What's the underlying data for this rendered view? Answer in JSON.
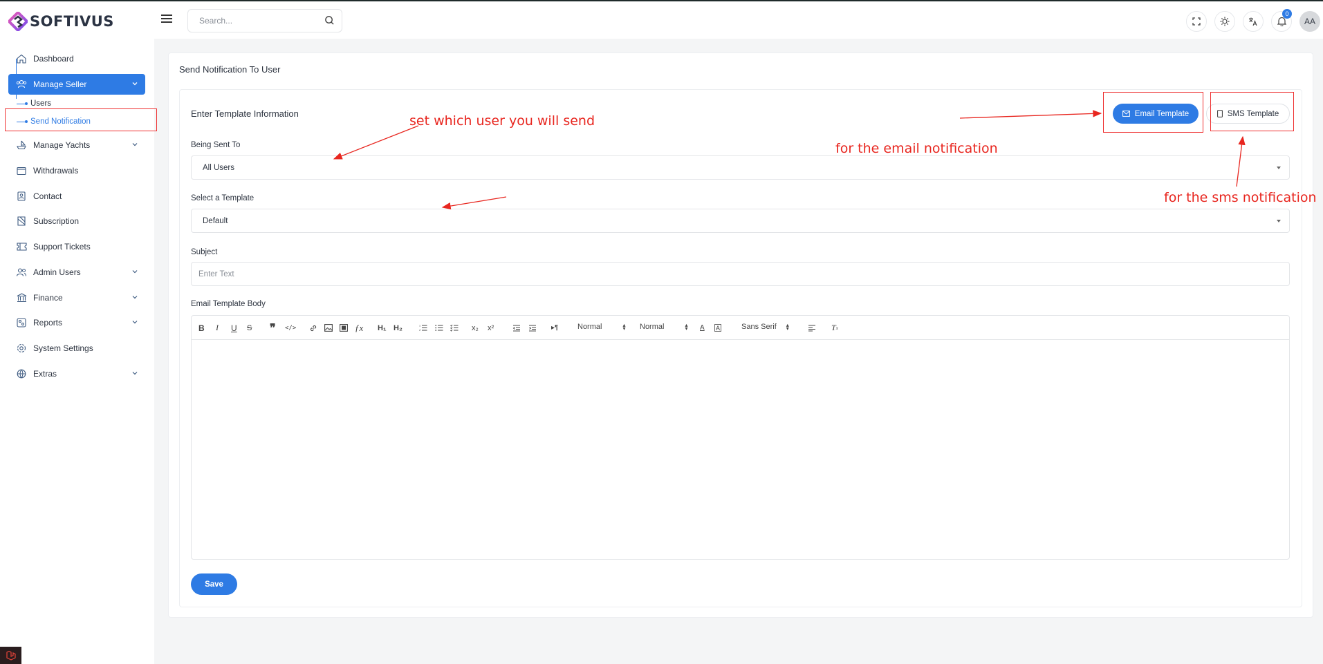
{
  "header": {
    "brand": "SOFTIVUS",
    "search_placeholder": "Search...",
    "notification_count": "0",
    "avatar_initials": "AA",
    "icons": [
      "fullscreen-icon",
      "sun-icon",
      "translate-icon",
      "bell-icon"
    ]
  },
  "sidebar": {
    "items": [
      {
        "label": "Dashboard",
        "icon": "home-icon"
      },
      {
        "label": "Manage Seller",
        "icon": "users-icon",
        "active": true,
        "expanded": true
      },
      {
        "label": "Manage Yachts",
        "icon": "ship-icon"
      },
      {
        "label": "Withdrawals",
        "icon": "wallet-icon"
      },
      {
        "label": "Contact",
        "icon": "contact-icon"
      },
      {
        "label": "Subscription",
        "icon": "subscription-icon"
      },
      {
        "label": "Support Tickets",
        "icon": "ticket-icon"
      },
      {
        "label": "Admin Users",
        "icon": "admin-users-icon"
      },
      {
        "label": "Finance",
        "icon": "bank-icon"
      },
      {
        "label": "Reports",
        "icon": "reports-icon"
      },
      {
        "label": "System Settings",
        "icon": "gear-icon"
      },
      {
        "label": "Extras",
        "icon": "extras-icon"
      }
    ],
    "sub_items": [
      {
        "label": "Users"
      },
      {
        "label": "Send Notification",
        "current": true
      }
    ]
  },
  "main": {
    "page_title": "Send Notification To User",
    "section_title": "Enter Template Information",
    "email_template_btn": "Email Template",
    "sms_template_btn": "SMS Template",
    "being_sent_to_label": "Being Sent To",
    "being_sent_to_value": "All Users",
    "select_template_label": "Select a Template",
    "select_template_value": "Default",
    "subject_label": "Subject",
    "subject_placeholder": "Enter Text",
    "body_label": "Email Template Body",
    "toolbar": {
      "header_select": "Normal",
      "size_select": "Normal",
      "font_select": "Sans Serif"
    },
    "save_label": "Save"
  },
  "annotations": {
    "user_note": "set which user you will send",
    "email_note": "for the email notification",
    "sms_note": "for the sms notification",
    "color": "#e8261f"
  },
  "colors": {
    "primary": "#2e7be4",
    "annotation": "#e8261f"
  }
}
